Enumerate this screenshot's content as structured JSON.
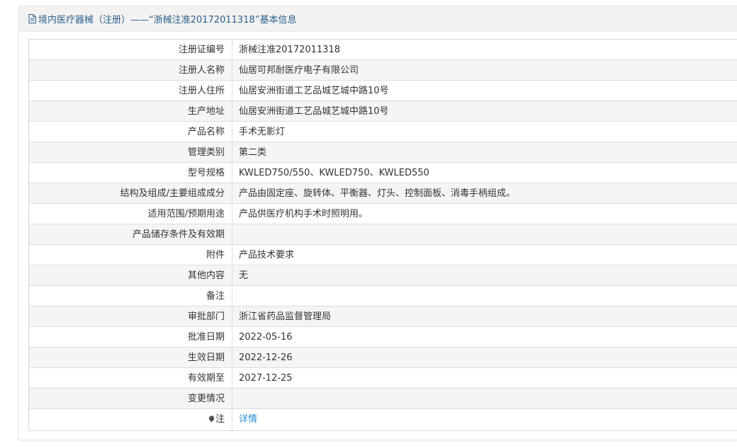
{
  "header": {
    "title": "境内医疗器械（注册）——“浙械注准20172011318”基本信息"
  },
  "rows": [
    {
      "label": "注册证编号",
      "value": "浙械注准20172011318"
    },
    {
      "label": "注册人名称",
      "value": "仙居可邦耐医疗电子有限公司"
    },
    {
      "label": "注册人住所",
      "value": "仙居安洲街道工艺品城艺城中路10号"
    },
    {
      "label": "生产地址",
      "value": "仙居安洲街道工艺品城艺城中路10号"
    },
    {
      "label": "产品名称",
      "value": "手术无影灯"
    },
    {
      "label": "管理类别",
      "value": "第二类"
    },
    {
      "label": "型号规格",
      "value": "KWLED750/550、KWLED750、KWLED550"
    },
    {
      "label": "结构及组成/主要组成成分",
      "value": "产品由固定座、旋转体、平衡器、灯头、控制面板、消毒手柄组成。"
    },
    {
      "label": "适用范围/预期用途",
      "value": "产品供医疗机构手术时照明用。"
    },
    {
      "label": "产品储存条件及有效期",
      "value": ""
    },
    {
      "label": "附件",
      "value": "产品技术要求"
    },
    {
      "label": "其他内容",
      "value": "无"
    },
    {
      "label": "备注",
      "value": ""
    },
    {
      "label": "审批部门",
      "value": "浙江省药品监督管理局"
    },
    {
      "label": "批准日期",
      "value": "2022-05-16"
    },
    {
      "label": "生效日期",
      "value": "2022-12-26"
    },
    {
      "label": "有效期至",
      "value": "2027-12-25"
    },
    {
      "label": "变更情况",
      "value": ""
    }
  ],
  "note_row": {
    "label": "注",
    "link_text": "详情",
    "icon": "pin-icon"
  },
  "colors": {
    "header_text": "#2b5f8c",
    "link": "#2a8bd1"
  }
}
